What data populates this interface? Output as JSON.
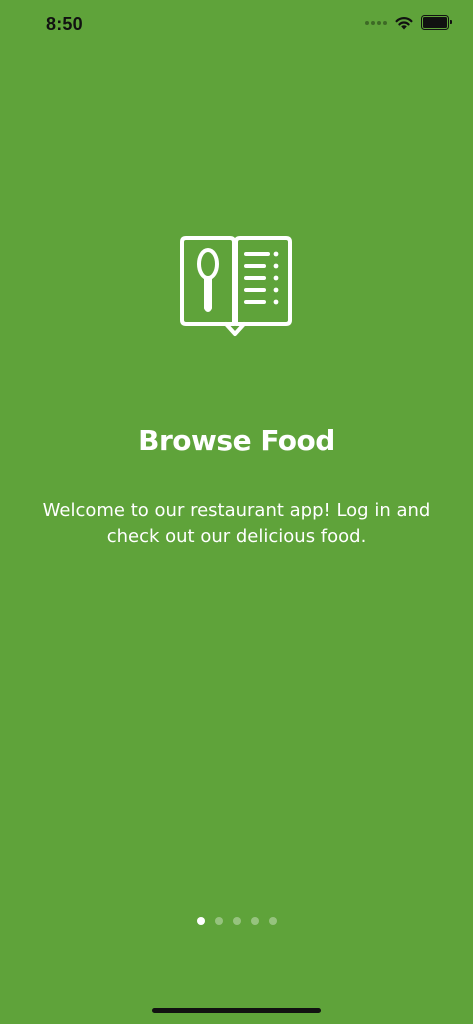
{
  "status_bar": {
    "time": "8:50",
    "icons": [
      "signal-icon",
      "wifi-icon",
      "battery-icon"
    ]
  },
  "onboarding": {
    "icon": "menu-book-spoon-icon",
    "title": "Browse Food",
    "description": "Welcome to our restaurant app! Log in and check out our delicious food."
  },
  "pager": {
    "page_count": 5,
    "current_page": 1
  },
  "colors": {
    "background": "#5fa33a",
    "text": "#ffffff",
    "status_bar_text": "#111111"
  }
}
